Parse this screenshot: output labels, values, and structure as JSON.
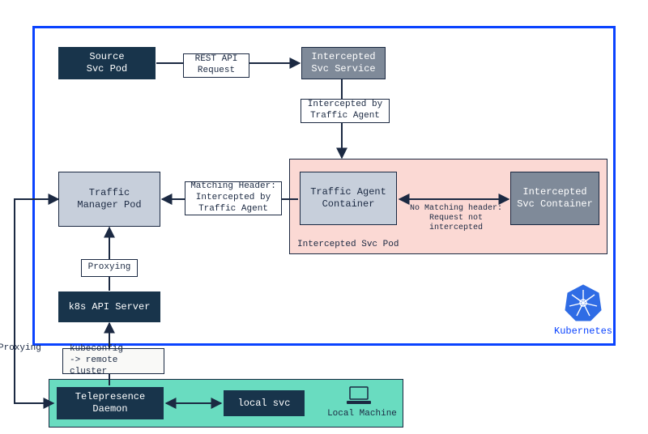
{
  "cluster_label": "Kubernetes",
  "source_pod": "Source\nSvc Pod",
  "arrow_rest": "REST API\nRequest",
  "intercepted_service": "Intercepted\nSvc Service",
  "arrow_intercepted_by": "Intercepted by\nTraffic Agent",
  "pod_caption": "Intercepted Svc Pod",
  "traffic_agent": "Traffic Agent\nContainer",
  "arrow_no_match": "No Matching header:\nRequest not intercepted",
  "intercepted_container": "Intercepted\nSvc Container",
  "arrow_match": "Matching Header:\nIntercepted by\nTraffic Agent",
  "traffic_manager": "Traffic\nManager Pod",
  "arrow_proxying_up": "Proxying",
  "k8s_api": "k8s API Server",
  "arrow_kubeconfig": "kubeconfig\n-> remote cluster",
  "arrow_proxying_side": "Proxying",
  "telepresence": "Telepresence\nDaemon",
  "local_svc": "local svc",
  "local_machine_label": "Local Machine"
}
